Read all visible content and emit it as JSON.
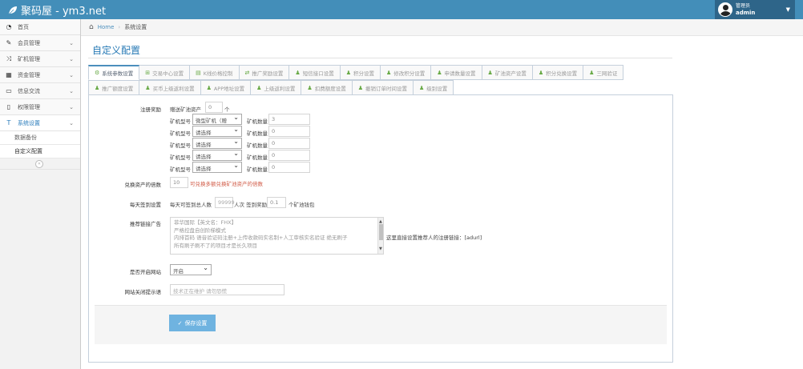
{
  "header": {
    "brand": "聚码屋 - ym3.net",
    "user_role": "管理员",
    "user_name": "admin"
  },
  "sidebar": {
    "items": [
      {
        "label": "首页",
        "icon": "dashboard-icon"
      },
      {
        "label": "会员管理",
        "icon": "edit-icon"
      },
      {
        "label": "矿机管理",
        "icon": "shuffle-icon"
      },
      {
        "label": "资金管理",
        "icon": "calendar-icon"
      },
      {
        "label": "信息交流",
        "icon": "chat-icon"
      },
      {
        "label": "权限管理",
        "icon": "file-icon"
      },
      {
        "label": "系统设置",
        "icon": "text-icon"
      }
    ],
    "subitems": [
      "数据备份",
      "自定义配置"
    ]
  },
  "breadcrumb": {
    "home": "Home",
    "current": "系统设置"
  },
  "page": {
    "title": "自定义配置"
  },
  "tabs_row1": [
    "系统参数设置",
    "交易中心设置",
    "K线价格控制",
    "推广奖励设置",
    "短信接口设置",
    "积分设置",
    "修改积分设置",
    "申请数量设置",
    "矿池资产设置",
    "积分兑换设置",
    "三网验证"
  ],
  "tabs_row2": [
    "推广额度设置",
    "买币上级返利设置",
    "APP地址设置",
    "上级返利设置",
    "扣费额度设置",
    "撤销订单时间设置",
    "级别设置"
  ],
  "form": {
    "reg_reward_label": "注册奖励",
    "gift_pool_label": "赠送矿池资产",
    "gift_pool_value": "0",
    "gift_unit": "个",
    "miner_type_label": "矿机型号",
    "miner_qty_label": "矿机数量",
    "miners": [
      {
        "type": "微型矿机（赠",
        "qty": "3"
      },
      {
        "type": "请选择",
        "qty": "0"
      },
      {
        "type": "请选择",
        "qty": "0"
      },
      {
        "type": "请选择",
        "qty": "0"
      },
      {
        "type": "请选择",
        "qty": "0"
      }
    ],
    "exchange_label": "兑换资产的倍数",
    "exchange_value": "10",
    "exchange_note": "可兑换多额兑换矿池资产的倍数",
    "signin_label": "每天签到设置",
    "signin_prefix": "每天可签到总人数",
    "signin_people": "99999",
    "signin_mid": "人次 签到奖励",
    "signin_reward": "0.1",
    "signin_suffix": "个矿池钱包",
    "ad_label": "推荐链接广告",
    "ad_lines": [
      "菲华国际【英文名：FHX】",
      "严格控盘自创阶梯模式",
      "内排首码 语音验证码注册+上传收款码实名制+人工审核实名验证 绝无刷子",
      "所有刷子刷不了的项目才是长久项目"
    ],
    "ad_hint": "这里直接设置推荐人的注册链接：[adurl]",
    "site_open_label": "是否开启网站",
    "site_open_value": "开启",
    "close_tip_label": "网站关闭提示语",
    "close_tip_value": "技术正在维护 请勿恐慌",
    "save_label": "保存设置"
  }
}
